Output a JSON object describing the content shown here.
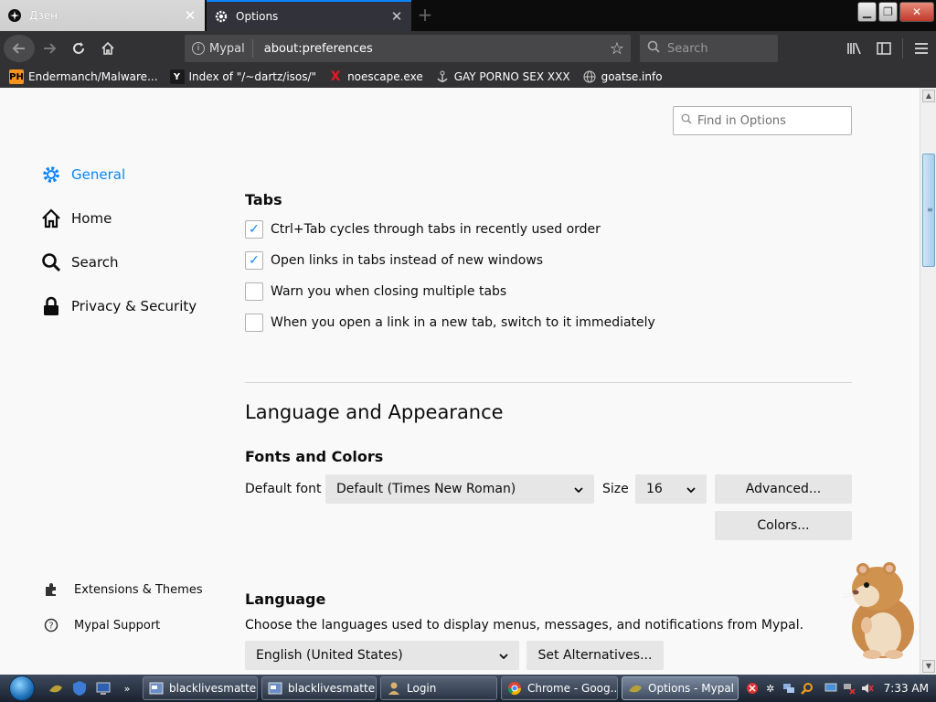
{
  "browser": {
    "tabs": [
      {
        "title": "Дзен",
        "icon": "zen-icon"
      },
      {
        "title": "Options",
        "icon": "gear-icon"
      }
    ],
    "new_tab_label": "+",
    "identity_label": "Mypal",
    "url": "about:preferences",
    "search_placeholder": "Search",
    "bookmarks": [
      {
        "label": "Endermanch/Malware...",
        "icon_text": "PH",
        "icon_color": "#f7931e"
      },
      {
        "label": "Index of \"/~dartz/isos/\"",
        "icon_text": "Y",
        "icon_color": "#1a1a1a"
      },
      {
        "label": "noescape.exe",
        "icon_text": "X",
        "icon_color": "#e31b23"
      },
      {
        "label": "GAY PORNO SEX XXX",
        "icon_text": "",
        "icon_color": "#ccc"
      },
      {
        "label": "goatse.info",
        "icon_text": "",
        "icon_color": "#ccc"
      }
    ]
  },
  "prefs": {
    "find_placeholder": "Find in Options",
    "categories": [
      {
        "label": "General",
        "icon": "gear-icon",
        "selected": true
      },
      {
        "label": "Home",
        "icon": "home-icon",
        "selected": false
      },
      {
        "label": "Search",
        "icon": "search-icon",
        "selected": false
      },
      {
        "label": "Privacy & Security",
        "icon": "lock-icon",
        "selected": false
      }
    ],
    "footer_links": [
      {
        "label": "Extensions & Themes",
        "icon": "puzzle-icon"
      },
      {
        "label": "Mypal Support",
        "icon": "help-icon"
      }
    ],
    "tabs_section": {
      "title": "Tabs",
      "options": [
        {
          "label": "Ctrl+Tab cycles through tabs in recently used order",
          "checked": true
        },
        {
          "label": "Open links in tabs instead of new windows",
          "checked": true
        },
        {
          "label": "Warn you when closing multiple tabs",
          "checked": false
        },
        {
          "label": "When you open a link in a new tab, switch to it immediately",
          "checked": false
        }
      ]
    },
    "language_appearance": {
      "title": "Language and Appearance",
      "fonts_title": "Fonts and Colors",
      "default_font_label": "Default font",
      "default_font_value": "Default (Times New Roman)",
      "size_label": "Size",
      "size_value": "16",
      "advanced_button": "Advanced...",
      "colors_button": "Colors..."
    },
    "language": {
      "title": "Language",
      "description": "Choose the languages used to display menus, messages, and notifications from Mypal.",
      "selected": "English (United States)",
      "alternatives_button": "Set Alternatives..."
    }
  },
  "taskbar": {
    "tasks": [
      {
        "label": "blacklivesmatte...",
        "active": false
      },
      {
        "label": "blacklivesmatte...",
        "active": false
      },
      {
        "label": "Login",
        "active": false
      },
      {
        "label": "Chrome - Goog...",
        "active": false
      },
      {
        "label": "Options - Mypal",
        "active": true
      }
    ],
    "clock": "7:33 AM"
  },
  "colors": {
    "accent": "#0a84ff",
    "toolbar": "#323234",
    "tab_strip": "#0c0c0d"
  }
}
